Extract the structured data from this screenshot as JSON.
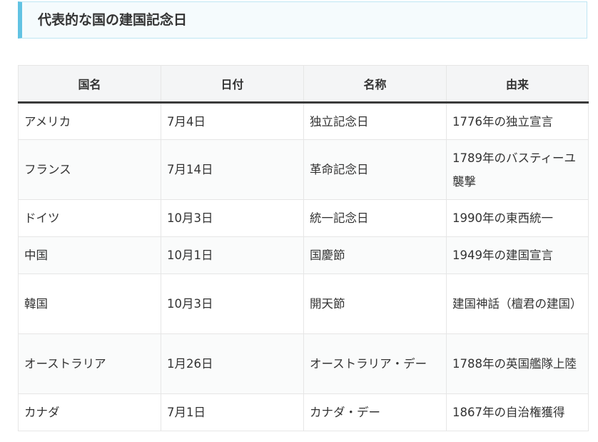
{
  "heading": {
    "title": "代表的な国の建国記念日"
  },
  "table": {
    "headers": [
      "国名",
      "日付",
      "名称",
      "由来"
    ],
    "rows": [
      {
        "country": "アメリカ",
        "date": "7月4日",
        "name": "独立記念日",
        "origin": "1776年の独立宣言"
      },
      {
        "country": "フランス",
        "date": "7月14日",
        "name": "革命記念日",
        "origin": "1789年のバスティーユ襲撃"
      },
      {
        "country": "ドイツ",
        "date": "10月3日",
        "name": "統一記念日",
        "origin": "1990年の東西統一"
      },
      {
        "country": "中国",
        "date": "10月1日",
        "name": "国慶節",
        "origin": "1949年の建国宣言"
      },
      {
        "country": "韓国",
        "date": "10月3日",
        "name": "開天節",
        "origin": "建国神話（檀君の建国）"
      },
      {
        "country": "オーストラリア",
        "date": "1月26日",
        "name": "オーストラリア・デー",
        "origin": "1788年の英国艦隊上陸"
      },
      {
        "country": "カナダ",
        "date": "7月1日",
        "name": "カナダ・デー",
        "origin": "1867年の自治権獲得"
      }
    ]
  },
  "colors": {
    "heading_accent": "#62c3e3",
    "heading_background": "#f5fbfd",
    "header_background": "#f4f5f6",
    "header_rule": "#3a3a3a",
    "text": "#333333"
  }
}
